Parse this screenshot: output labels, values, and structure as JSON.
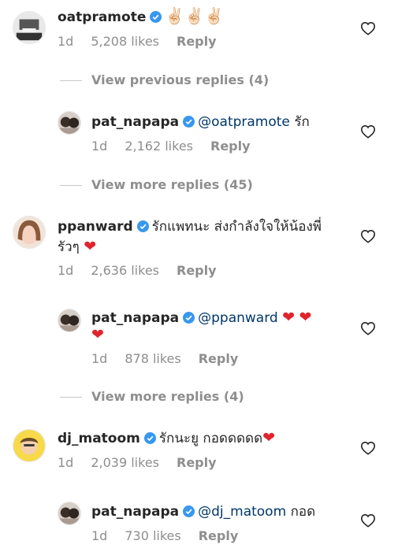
{
  "comments": [
    {
      "username": "oatpramote",
      "text": "✌🏻✌🏻✌🏻",
      "age": "1d",
      "likes": "5,208 likes",
      "reply": "Reply"
    },
    {
      "username": "pat_napapa",
      "mention": "@oatpramote",
      "text": "รัก",
      "age": "1d",
      "likes": "2,162 likes",
      "reply": "Reply"
    },
    {
      "username": "ppanward",
      "text_line1": "รักแพทนะ ส่งกำลังใจให้น้องพี่",
      "text_line2": "รัวๆ",
      "age": "1d",
      "likes": "2,636 likes",
      "reply": "Reply"
    },
    {
      "username": "pat_napapa",
      "mention": "@ppanward",
      "age": "1d",
      "likes": "878 likes",
      "reply": "Reply"
    },
    {
      "username": "dj_matoom",
      "text": "รักนะยู กอดดดดด",
      "age": "1d",
      "likes": "2,039 likes",
      "reply": "Reply"
    },
    {
      "username": "pat_napapa",
      "mention": "@dj_matoom",
      "text": "กอด",
      "age": "1d",
      "likes": "730 likes",
      "reply": "Reply"
    }
  ],
  "view_replies": {
    "previous": "View previous replies (4)",
    "more_1": "View more replies (45)",
    "more_2": "View more replies (4)"
  },
  "colors": {
    "verified": "#3897f0",
    "heart": "#e0242e",
    "mention": "#00376b",
    "meta": "#8e8e8e"
  },
  "icons": {
    "verified": "verified-badge-icon",
    "like": "heart-outline-icon",
    "emoji_heart": "red-heart-emoji"
  }
}
